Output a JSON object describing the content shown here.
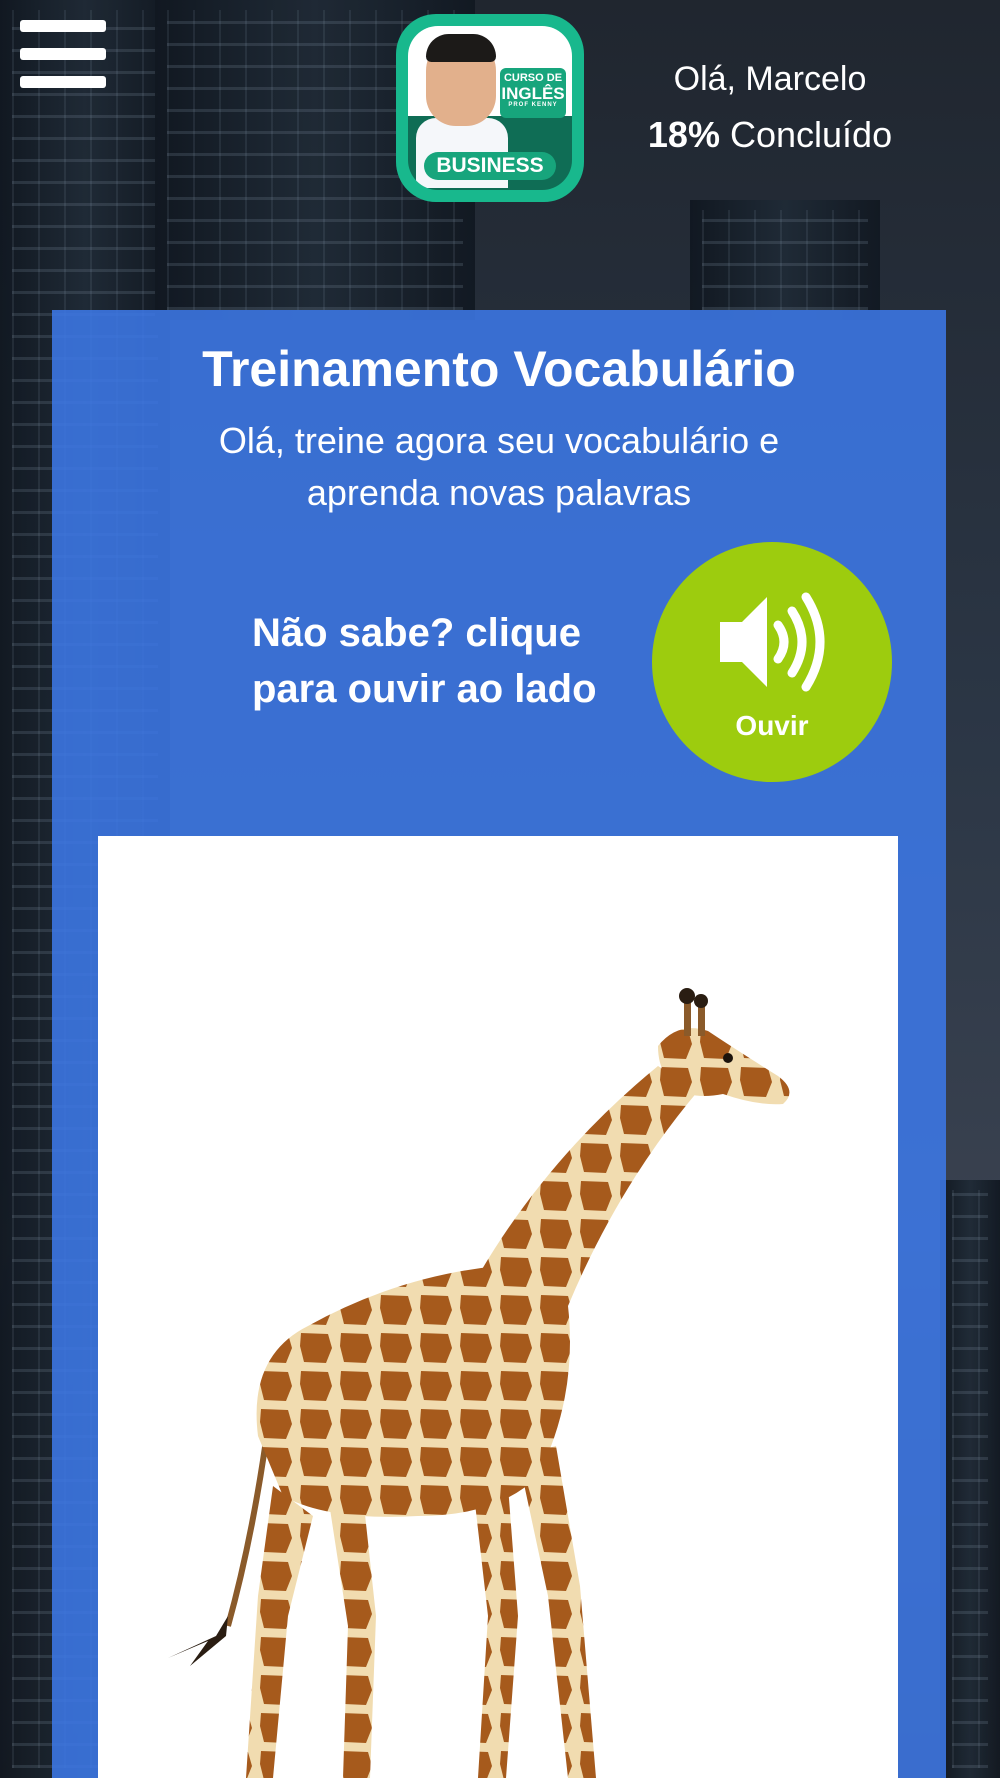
{
  "header": {
    "menu_icon": "hamburger-menu-icon",
    "logo": {
      "line1": "CURSO DE",
      "line2": "INGLÊS",
      "line3": "PROF KENNY",
      "badge": "BUSINESS"
    },
    "greeting": "Olá, Marcelo",
    "progress_value": "18%",
    "progress_label": "Concluído"
  },
  "panel": {
    "title": "Treinamento Vocabulário",
    "subtitle": "Olá, treine agora seu vocabulário e aprenda novas palavras",
    "hint": "Não sabe? clique para ouvir ao lado",
    "listen_button": {
      "icon": "speaker-icon",
      "label": "Ouvir"
    },
    "image": {
      "subject": "giraffe"
    }
  },
  "colors": {
    "panel_blue": "#3c78e6",
    "listen_green": "#9dcc0e",
    "logo_green": "#18b88d"
  }
}
